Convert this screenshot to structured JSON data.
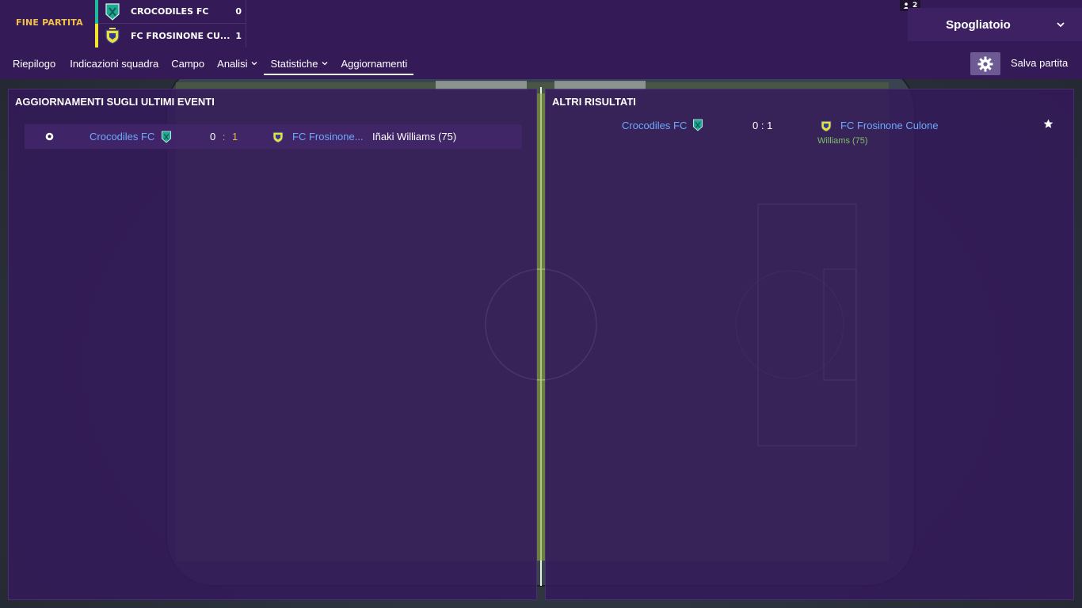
{
  "header": {
    "match_state": "FINE PARTITA",
    "home_team": "CROCODILES FC",
    "home_score": "0",
    "away_team": "FC FROSINONE CU...",
    "away_score": "1",
    "players_count": "2",
    "room": "Spogliatoio",
    "save_label": "Salva partita"
  },
  "nav": {
    "items": [
      {
        "label": "Riepilogo"
      },
      {
        "label": "Indicazioni squadra"
      },
      {
        "label": "Campo"
      },
      {
        "label": "Analisi"
      },
      {
        "label": "Statistiche"
      },
      {
        "label": "Aggiornamenti"
      }
    ]
  },
  "events_panel": {
    "title": "AGGIORNAMENTI SUGLI ULTIMI EVENTI",
    "rows": [
      {
        "home": "Crocodiles FC",
        "home_score": "0",
        "separator": ":",
        "away_score": "1",
        "away": "FC Frosinone...",
        "scorer": "Iñaki Williams (75)"
      }
    ]
  },
  "results_panel": {
    "title": "ALTRI RISULTATI",
    "rows": [
      {
        "home": "Crocodiles FC",
        "score": "0 : 1",
        "away": "FC Frosinone Culone",
        "scorer": "Williams (75)"
      }
    ]
  },
  "colors": {
    "header_bg": "#351a58",
    "home_color": "#1bbd9d",
    "away_color": "#f3e52b",
    "match_state": "#f2c14a",
    "link": "#6fa8ff",
    "scorer_green": "#7fbf6a",
    "accent_score": "#e7b34a"
  },
  "icons": {
    "home_badge": "crocodiles-badge-icon",
    "away_badge": "frosinone-badge-icon",
    "event_type": "football-icon",
    "settings": "gear-icon",
    "favourite": "star-icon",
    "players": "person-icon",
    "dropdown": "chevron-down-icon"
  }
}
